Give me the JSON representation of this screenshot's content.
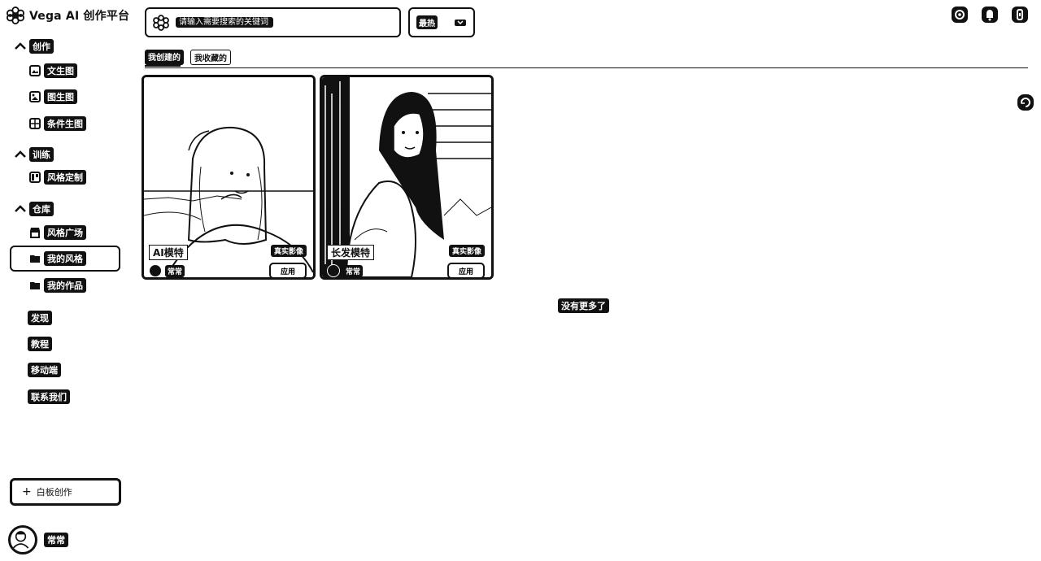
{
  "brand": {
    "name": "Vega AI 创作平台"
  },
  "sidebar": {
    "sections": [
      {
        "label": "创作",
        "items": [
          {
            "label": "文生图"
          },
          {
            "label": "图生图"
          },
          {
            "label": "条件生图"
          }
        ]
      },
      {
        "label": "训练",
        "items": [
          {
            "label": "风格定制"
          }
        ]
      },
      {
        "label": "仓库",
        "items": [
          {
            "label": "风格广场"
          },
          {
            "label": "我的风格"
          },
          {
            "label": "我的作品"
          }
        ]
      }
    ],
    "links": [
      "发现",
      "教程",
      "移动端",
      "联系我们"
    ],
    "whiteboard_button": "白板创作",
    "user_name": "常常"
  },
  "header": {
    "search_placeholder": "请输入需要搜索的关键词",
    "sort_label": "最热"
  },
  "tabs": [
    {
      "label": "我创建的",
      "active": true
    },
    {
      "label": "我收藏的",
      "active": false
    }
  ],
  "cards": [
    {
      "title": "AI模特",
      "tag": "真实影像",
      "creator": "常常",
      "apply_label": "应用"
    },
    {
      "title": "长发模特",
      "tag": "真实影像",
      "creator": "常常",
      "apply_label": "应用"
    }
  ],
  "footer_message": "没有更多了",
  "icons": {
    "brand": "flower-logo-icon",
    "settings": "gear-icon",
    "notifications": "bell-icon",
    "user_action": "user-badge-icon",
    "float": "refresh-icon"
  }
}
